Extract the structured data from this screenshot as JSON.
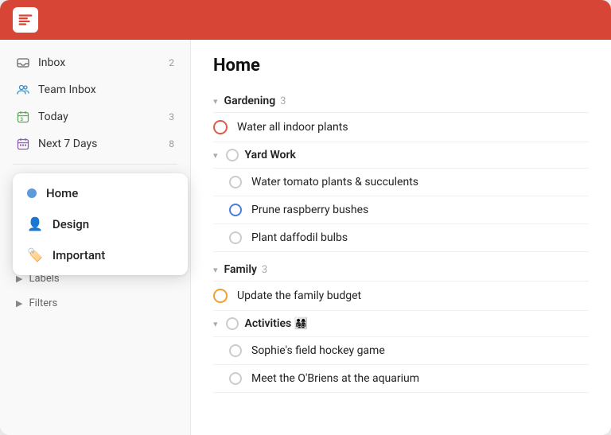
{
  "app": {
    "title": "Todoist"
  },
  "sidebar": {
    "items": [
      {
        "id": "inbox",
        "label": "Inbox",
        "count": "2",
        "icon": "inbox"
      },
      {
        "id": "team-inbox",
        "label": "Team Inbox",
        "count": "",
        "icon": "team"
      },
      {
        "id": "today",
        "label": "Today",
        "count": "3",
        "icon": "today"
      },
      {
        "id": "next7days",
        "label": "Next 7 Days",
        "count": "8",
        "icon": "next7"
      }
    ],
    "sections": {
      "labels_label": "Labels",
      "filters_label": "Filters"
    }
  },
  "projects_dropdown": {
    "items": [
      {
        "id": "home",
        "label": "Home",
        "color": "#5b9bdc"
      },
      {
        "id": "design",
        "label": "Design",
        "color": "#f0b429"
      },
      {
        "id": "important",
        "label": "Important",
        "color": "#e05a4a"
      }
    ]
  },
  "main": {
    "title": "Home",
    "sections": [
      {
        "id": "gardening",
        "label": "Gardening",
        "count": "3",
        "collapsed": false,
        "tasks": [
          {
            "id": "t1",
            "text": "Water all indoor plants",
            "circle": "red",
            "sub": false
          }
        ],
        "subsections": [
          {
            "id": "yard-work",
            "label": "Yard Work",
            "tasks": [
              {
                "id": "t2",
                "text": "Water tomato plants & succulents",
                "circle": "default",
                "sub": true
              },
              {
                "id": "t3",
                "text": "Prune raspberry bushes",
                "circle": "blue",
                "sub": true
              },
              {
                "id": "t4",
                "text": "Plant daffodil bulbs",
                "circle": "default",
                "sub": true
              }
            ]
          }
        ]
      },
      {
        "id": "family",
        "label": "Family",
        "count": "3",
        "collapsed": false,
        "tasks": [
          {
            "id": "t5",
            "text": "Update the family budget",
            "circle": "orange",
            "sub": false
          }
        ],
        "subsections": [
          {
            "id": "activities",
            "label": "Activities 👨‍👩‍👧‍👦",
            "tasks": [
              {
                "id": "t6",
                "text": "Sophie's field hockey game",
                "circle": "default",
                "sub": true
              },
              {
                "id": "t7",
                "text": "Meet the O'Briens at the aquarium",
                "circle": "default",
                "sub": true
              }
            ]
          }
        ]
      }
    ]
  }
}
